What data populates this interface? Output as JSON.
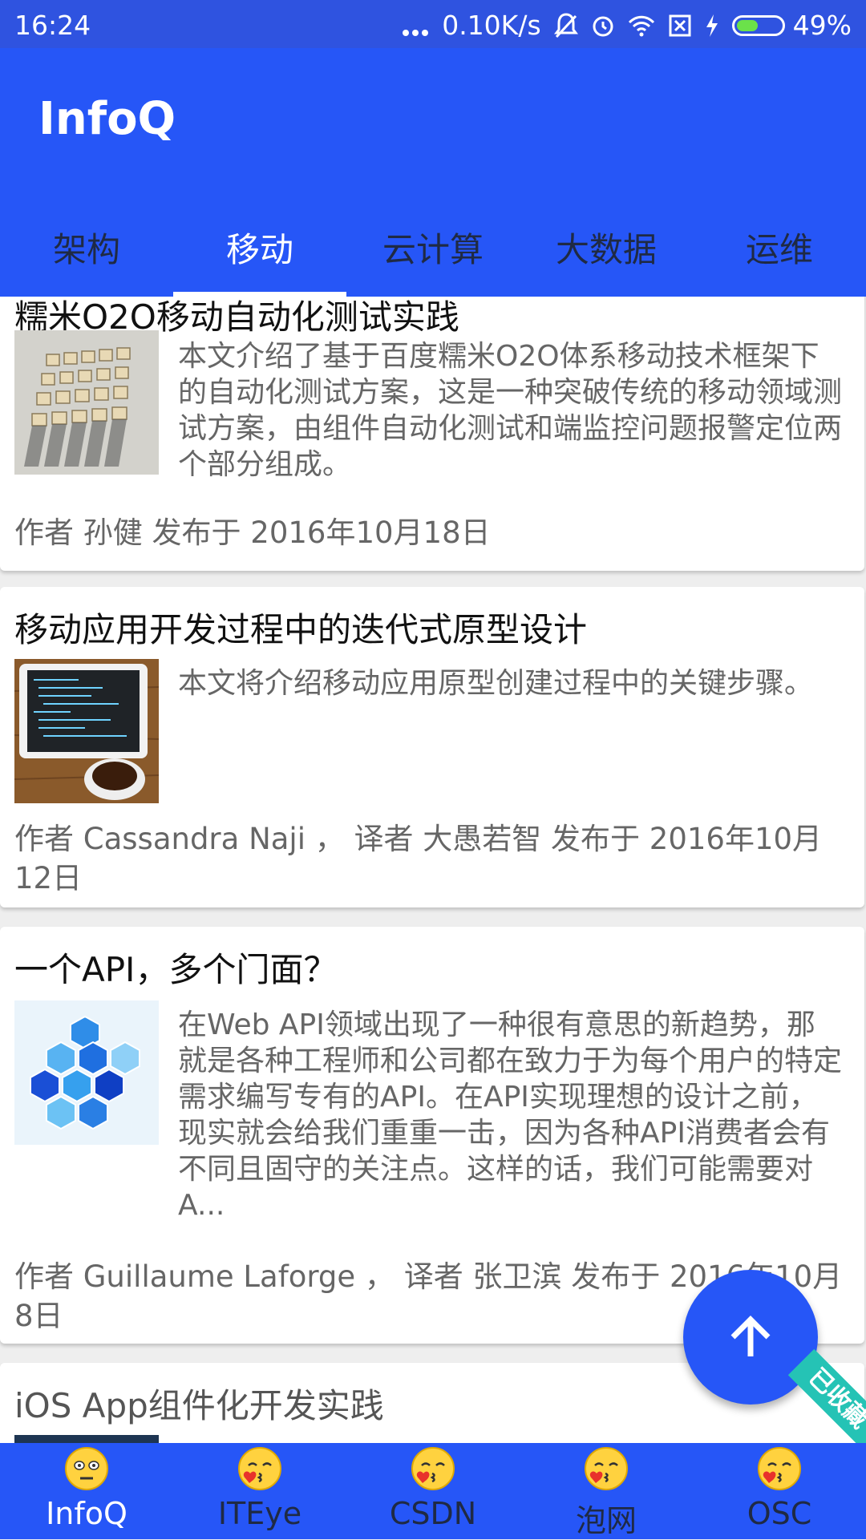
{
  "status_bar": {
    "time": "16:24",
    "network_speed": "0.10K/s",
    "battery_percent": "49%",
    "battery_level": 0.49,
    "icons": [
      "more-dots-icon",
      "bell-muted-icon",
      "alarm-icon",
      "wifi-icon",
      "sim-x-icon",
      "charging-icon",
      "battery-icon"
    ]
  },
  "app_bar": {
    "title": "InfoQ"
  },
  "tabs": [
    {
      "label": "架构",
      "active": false
    },
    {
      "label": "移动",
      "active": true
    },
    {
      "label": "云计算",
      "active": false
    },
    {
      "label": "大数据",
      "active": false
    },
    {
      "label": "运维",
      "active": false
    }
  ],
  "articles": [
    {
      "title": "糯米O2O移动自动化测试实践",
      "summary": "本文介绍了基于百度糯米O2O体系移动技术框架下的自动化测试方案，这是一种突破传统的移动领域测试方案，由组件自动化测试和端监控问题报警定位两个部分组成。",
      "meta": "作者 孙健 发布于  2016年10月18日",
      "thumb": "wooden-blocks-image"
    },
    {
      "title": "移动应用开发过程中的迭代式原型设计",
      "summary": "本文将介绍移动应用原型创建过程中的关键步骤。",
      "meta": "作者 Cassandra Naji ， 译者 大愚若智   发布于  2016年10月12日",
      "thumb": "tablet-coffee-image"
    },
    {
      "title": "一个API，多个门面？",
      "summary": "在Web API领域出现了一种很有意思的新趋势，那就是各种工程师和公司都在致力于为每个用户的特定需求编写专有的API。在API实现理想的设计之前，现实就会给我们重重一击，因为各种API消费者会有不同且固守的关注点。这样的话，我们可能需要对A...",
      "meta": "作者 Guillaume Laforge ， 译者 张卫滨   发布于  2016年10月8日",
      "thumb": "blue-hexagons-image"
    },
    {
      "title": "iOS App组件化开发实践",
      "thumb": "dark-code-image"
    }
  ],
  "fab": {
    "icon": "arrow-up-icon"
  },
  "collected_ribbon": {
    "label": "已收藏",
    "color": "#25c3b5"
  },
  "bottom_nav": [
    {
      "label": "InfoQ",
      "icon": "neutral-face-icon",
      "active": true
    },
    {
      "label": "ITEye",
      "icon": "kissing-face-icon",
      "active": false
    },
    {
      "label": "CSDN",
      "icon": "kissing-face-icon",
      "active": false
    },
    {
      "label": "泡网",
      "icon": "kissing-face-icon",
      "active": false
    },
    {
      "label": "OSC",
      "icon": "kissing-face-icon",
      "active": false
    }
  ],
  "colors": {
    "primary": "#2656f7",
    "status_bar": "#2f53e0",
    "tab_inactive": "#1f2a44",
    "accent_ribbon": "#25c3b5"
  }
}
